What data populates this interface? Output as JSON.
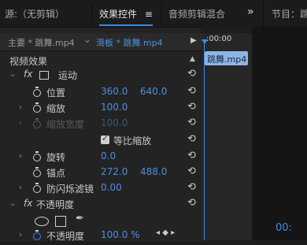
{
  "tabs": {
    "source": "源:（无剪辑）",
    "effect_controls": "效果控件",
    "menu_icon": "≡",
    "audio_mixer": "音频剪辑混合",
    "more": "»",
    "program": "节目：",
    "program_tail": "跳"
  },
  "subheader": {
    "master": "主要 * 跳舞.mp4",
    "dropdown": "⌄",
    "clip": "滑板 * 跳舞.mp4",
    "play": "▶"
  },
  "timeline": {
    "time": ":00:00",
    "clip_label": "跳舞.mp4",
    "program_time": "00:"
  },
  "section": "视频效果",
  "effects": {
    "motion": {
      "fx": "fx",
      "label": "运动"
    },
    "position": {
      "label": "位置",
      "x": "360.0",
      "y": "640.0"
    },
    "scale": {
      "label": "缩放",
      "value": "100.0"
    },
    "scale_width": {
      "label": "缩放宽度",
      "value": "100.0"
    },
    "uniform": {
      "label": "等比缩放"
    },
    "rotation": {
      "label": "旋转",
      "value": "0.0"
    },
    "anchor": {
      "label": "锚点",
      "x": "272.0",
      "y": "488.0"
    },
    "antiflicker": {
      "label": "防闪烁滤镜",
      "value": "0.00"
    },
    "opacity_group": {
      "fx": "fx",
      "label": "不透明度"
    },
    "opacity": {
      "label": "不透明度",
      "value": "100.0 %"
    }
  },
  "colors": {
    "accent": "#3b8be6",
    "clip": "#8db5e3"
  }
}
